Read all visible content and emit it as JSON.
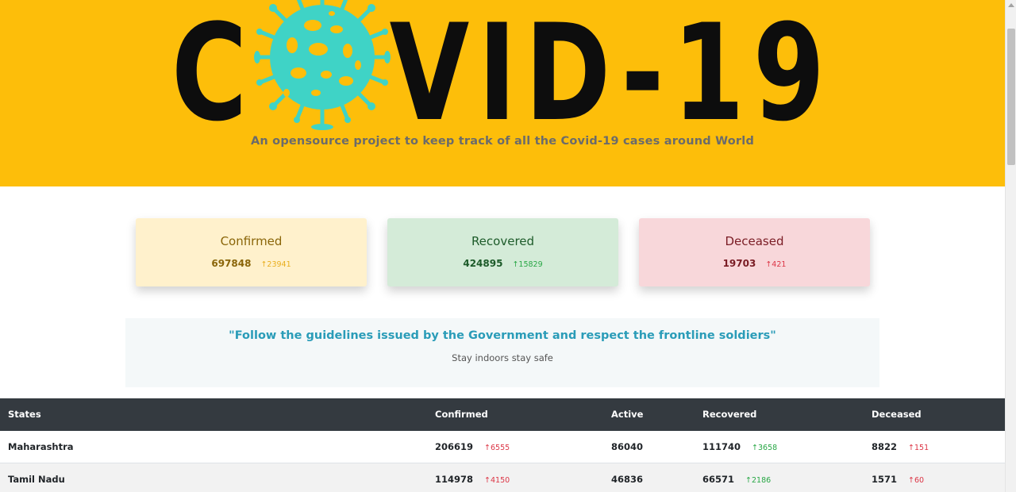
{
  "header": {
    "logo_text": "COVID-19",
    "tagline": "An opensource project to keep track of all the Covid-19 cases around World",
    "colors": {
      "background": "#fdbe0a",
      "virus": "#3fd3c6"
    }
  },
  "cards": {
    "confirmed": {
      "title": "Confirmed",
      "value": "697848",
      "delta": "23941"
    },
    "recovered": {
      "title": "Recovered",
      "value": "424895",
      "delta": "15829"
    },
    "deceased": {
      "title": "Deceased",
      "value": "19703",
      "delta": "421"
    }
  },
  "quote": {
    "text": "\"Follow the guidelines issued by the Government and respect the frontline soldiers\"",
    "sub": "Stay indoors stay safe"
  },
  "table": {
    "headers": [
      "States",
      "Confirmed",
      "Active",
      "Recovered",
      "Deceased"
    ],
    "rows": [
      {
        "state": "Maharashtra",
        "confirmed": "206619",
        "confirmed_delta": "6555",
        "active": "86040",
        "recovered": "111740",
        "recovered_delta": "3658",
        "deceased": "8822",
        "deceased_delta": "151"
      },
      {
        "state": "Tamil Nadu",
        "confirmed": "114978",
        "confirmed_delta": "4150",
        "active": "46836",
        "recovered": "66571",
        "recovered_delta": "2186",
        "deceased": "1571",
        "deceased_delta": "60"
      }
    ]
  },
  "icons": {
    "up_arrow": "arrow-up-icon",
    "virus": "virus-icon"
  }
}
